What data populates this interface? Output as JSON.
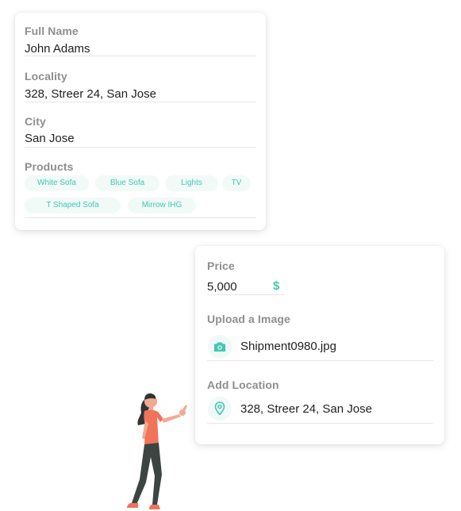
{
  "form_card": {
    "full_name": {
      "label": "Full Name",
      "value": "John Adams"
    },
    "locality": {
      "label": "Locality",
      "value": "328, Streer 24, San Jose"
    },
    "city": {
      "label": "City",
      "value": "San Jose"
    },
    "products": {
      "label": "Products",
      "chips": [
        "White Sofa",
        "Blue Sofa",
        "Lights",
        "TV",
        "T Shaped Sofa",
        "Mirrow IHG"
      ]
    }
  },
  "detail_card": {
    "price": {
      "label": "Price",
      "value": "5,000",
      "currency": "$"
    },
    "upload": {
      "label": "Upload a Image",
      "file_name": "Shipment0980.jpg",
      "icon": "camera-icon"
    },
    "location": {
      "label": "Add Location",
      "value": "328, Streer 24, San Jose",
      "icon": "map-pin-icon"
    }
  },
  "colors": {
    "accent": "#3fc7b1",
    "figure_top": "#f0735a",
    "figure_pants": "#3c4541",
    "figure_hair": "#2e3532"
  }
}
